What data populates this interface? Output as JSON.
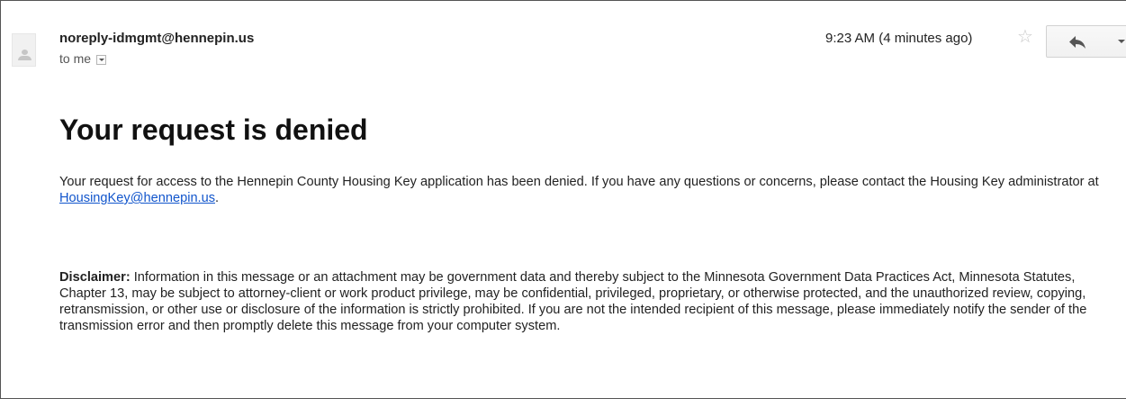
{
  "header": {
    "sender": "noreply-idmgmt@hennepin.us",
    "recipient_label": "to me",
    "timestamp": "9:23 AM (4 minutes ago)"
  },
  "icons": {
    "avatar": "default-avatar-icon",
    "star": "star-outline-icon",
    "reply": "reply-arrow-icon",
    "more": "chevron-down-icon",
    "details": "details-dropdown-icon"
  },
  "message": {
    "subject": "Your request is denied",
    "body_text": "Your request for access to the Hennepin County Housing Key application has been denied. If you have any questions or concerns, please contact the Housing Key administrator at ",
    "contact_email": "HousingKey@hennepin.us",
    "body_end": ".",
    "disclaimer_label": "Disclaimer:",
    "disclaimer_text": " Information in this message or an attachment may be government data and thereby subject to the Minnesota Government Data Practices Act, Minnesota Statutes, Chapter 13, may be subject to attorney-client or work product privilege, may be confidential, privileged, proprietary, or otherwise protected, and the unauthorized review, copying, retransmission, or other use or disclosure of the information is strictly prohibited. If you are not the intended recipient of this message, please immediately notify the sender of the transmission error and then promptly delete this message from your computer system."
  },
  "colors": {
    "link": "#1155cc",
    "text": "#222222",
    "star": "#c8c8c8"
  }
}
